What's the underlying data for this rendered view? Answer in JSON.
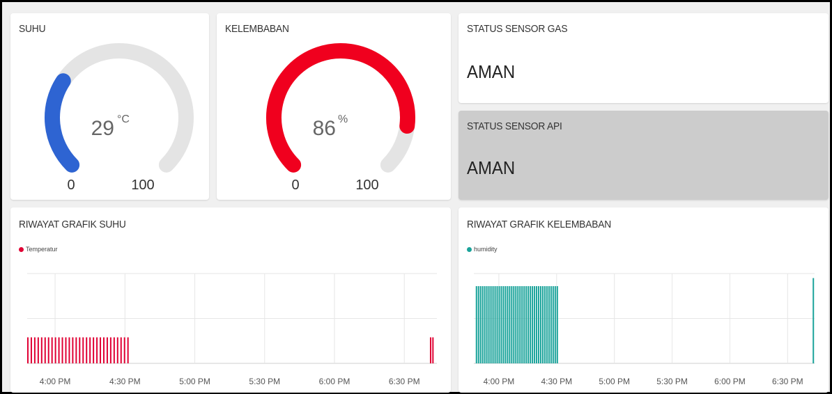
{
  "colors": {
    "temp_gauge": "#2e64d2",
    "humidity_gauge": "#f0001e",
    "gauge_track": "#e4e4e4",
    "temp_series": "#e00034",
    "humidity_series": "#1aa39a",
    "api_card_bg": "#cccccc"
  },
  "suhu": {
    "title": "SUHU",
    "value": "29",
    "unit": "°C",
    "min": "0",
    "max": "100",
    "level": 0.29
  },
  "kelembaban": {
    "title": "KELEMBABAN",
    "value": "86",
    "unit": "%",
    "min": "0",
    "max": "100",
    "level": 0.86
  },
  "gas": {
    "title": "STATUS SENSOR GAS",
    "value": "AMAN"
  },
  "api": {
    "title": "STATUS SENSOR API",
    "value": "AMAN"
  },
  "chart_data": [
    {
      "type": "bar",
      "title": "RIWAYAT GRAFIK SUHU",
      "series": [
        {
          "name": "Temperatur",
          "color": "#e00034",
          "bursts": [
            {
              "start": "3:48 PM",
              "end": "4:31 PM",
              "count": 30,
              "value": 0.29
            },
            {
              "start": "6:41 PM",
              "end": "6:42 PM",
              "count": 2,
              "value": 0.29
            }
          ]
        }
      ],
      "x_range": [
        "3:48 PM",
        "6:44 PM"
      ],
      "x_ticks": [
        "4:00 PM",
        "4:30 PM",
        "5:00 PM",
        "5:30 PM",
        "6:00 PM",
        "6:30 PM"
      ],
      "grid": true,
      "legend": "top-left"
    },
    {
      "type": "bar",
      "title": "RIWAYAT GRAFIK KELEMBABAN",
      "series": [
        {
          "name": "humidity",
          "color": "#1aa39a",
          "bursts": [
            {
              "start": "3:48 PM",
              "end": "4:30 PM",
              "count": 40,
              "value": 0.86
            },
            {
              "start": "6:43 PM",
              "end": "6:43 PM",
              "count": 1,
              "value": 0.95
            }
          ]
        }
      ],
      "x_range": [
        "3:47 PM",
        "6:44 PM"
      ],
      "x_ticks": [
        "4:00 PM",
        "4:30 PM",
        "5:00 PM",
        "5:30 PM",
        "6:00 PM",
        "6:30 PM"
      ],
      "grid": true,
      "legend": "top-left"
    }
  ]
}
